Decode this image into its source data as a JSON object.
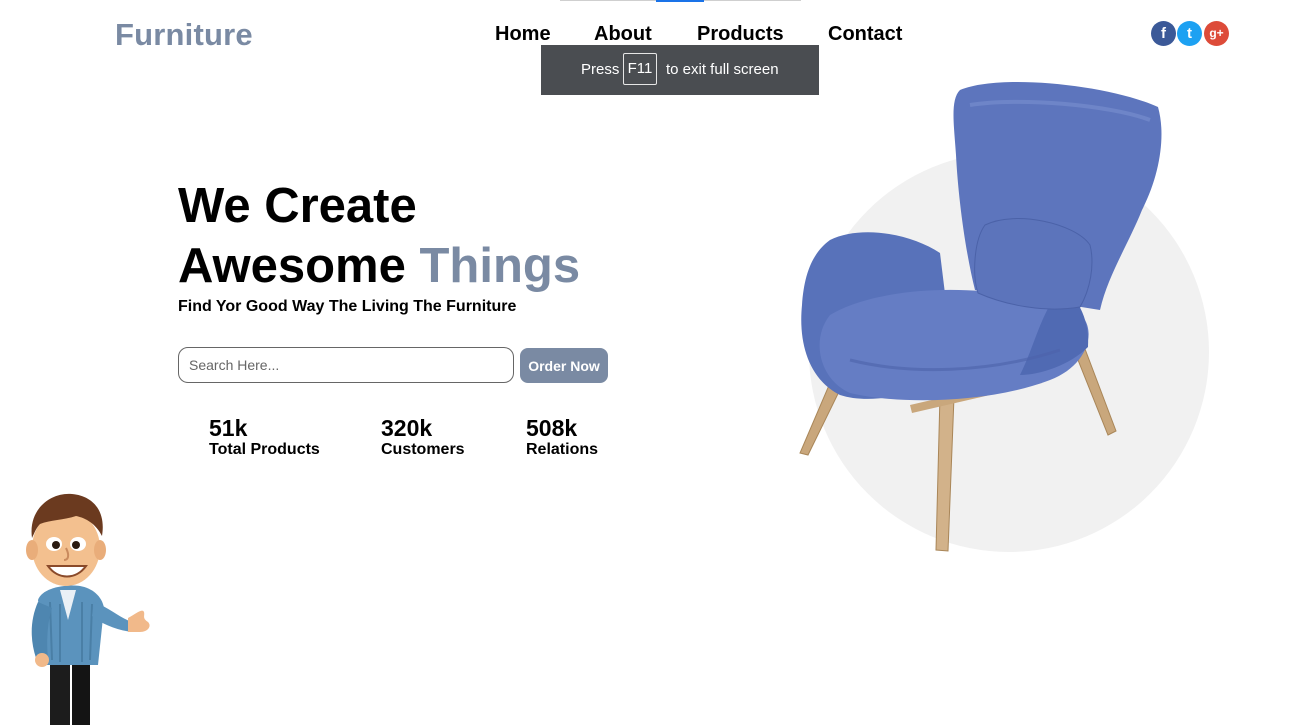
{
  "brand": {
    "name": "Furniture"
  },
  "nav": {
    "items": [
      "Home",
      "About",
      "Products",
      "Contact"
    ]
  },
  "social": [
    {
      "icon": "facebook-icon",
      "glyph": "f",
      "color": "#3b5998"
    },
    {
      "icon": "twitter-icon",
      "glyph": "t",
      "color": "#1da1f2"
    },
    {
      "icon": "google-plus-icon",
      "glyph": "g+",
      "color": "#dd4b39"
    }
  ],
  "fullscreen_toast": {
    "press": "Press",
    "key": "F11",
    "message": "to exit full screen"
  },
  "hero": {
    "line1": "We Create",
    "line2_plain": "Awesome",
    "line2_accent": "Things",
    "tagline": "Find Yor Good Way The Living The Furniture",
    "search_placeholder": "Search Here...",
    "cta": "Order Now"
  },
  "stats": [
    {
      "value": "51k",
      "label": "Total Products"
    },
    {
      "value": "320k",
      "label": "Customers"
    },
    {
      "value": "508k",
      "label": "Relations"
    }
  ],
  "colors": {
    "accent": "#7a8aa3",
    "chair": "#5a72b8",
    "circle": "#f1f1f1"
  }
}
